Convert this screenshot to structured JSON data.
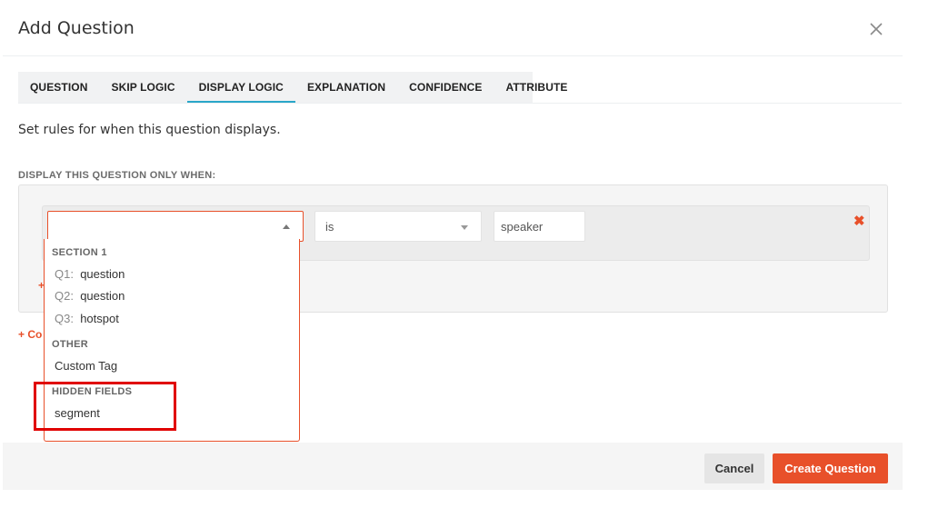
{
  "modal": {
    "title": "Add Question",
    "close_icon": "close-icon"
  },
  "tabs": [
    {
      "label": "QUESTION",
      "active": false
    },
    {
      "label": "SKIP LOGIC",
      "active": false
    },
    {
      "label": "DISPLAY LOGIC",
      "active": true
    },
    {
      "label": "EXPLANATION",
      "active": false
    },
    {
      "label": "CONFIDENCE",
      "active": false
    },
    {
      "label": "ATTRIBUTE",
      "active": false
    }
  ],
  "display_logic": {
    "description": "Set rules for when this question displays.",
    "section_label": "DISPLAY THIS QUESTION ONLY WHEN:",
    "rule": {
      "question_value": "",
      "operator": "is",
      "value": "speaker",
      "remove_symbol": "✖"
    },
    "add_rule_link": "+",
    "add_condition_link": "+ Co"
  },
  "dropdown": {
    "groups": [
      {
        "label": "SECTION 1",
        "items": [
          {
            "num": "Q1:",
            "text": "question"
          },
          {
            "num": "Q2:",
            "text": "question"
          },
          {
            "num": "Q3:",
            "text": "hotspot"
          }
        ]
      },
      {
        "label": "OTHER",
        "items": [
          {
            "num": "",
            "text": "Custom Tag"
          }
        ]
      },
      {
        "label": "HIDDEN FIELDS",
        "items": [
          {
            "num": "",
            "text": "segment"
          }
        ]
      }
    ]
  },
  "footer": {
    "cancel_label": "Cancel",
    "create_label": "Create Question"
  },
  "colors": {
    "accent": "#e8502a",
    "active_tab_underline": "#29a6c9",
    "highlight": "#e00000"
  }
}
